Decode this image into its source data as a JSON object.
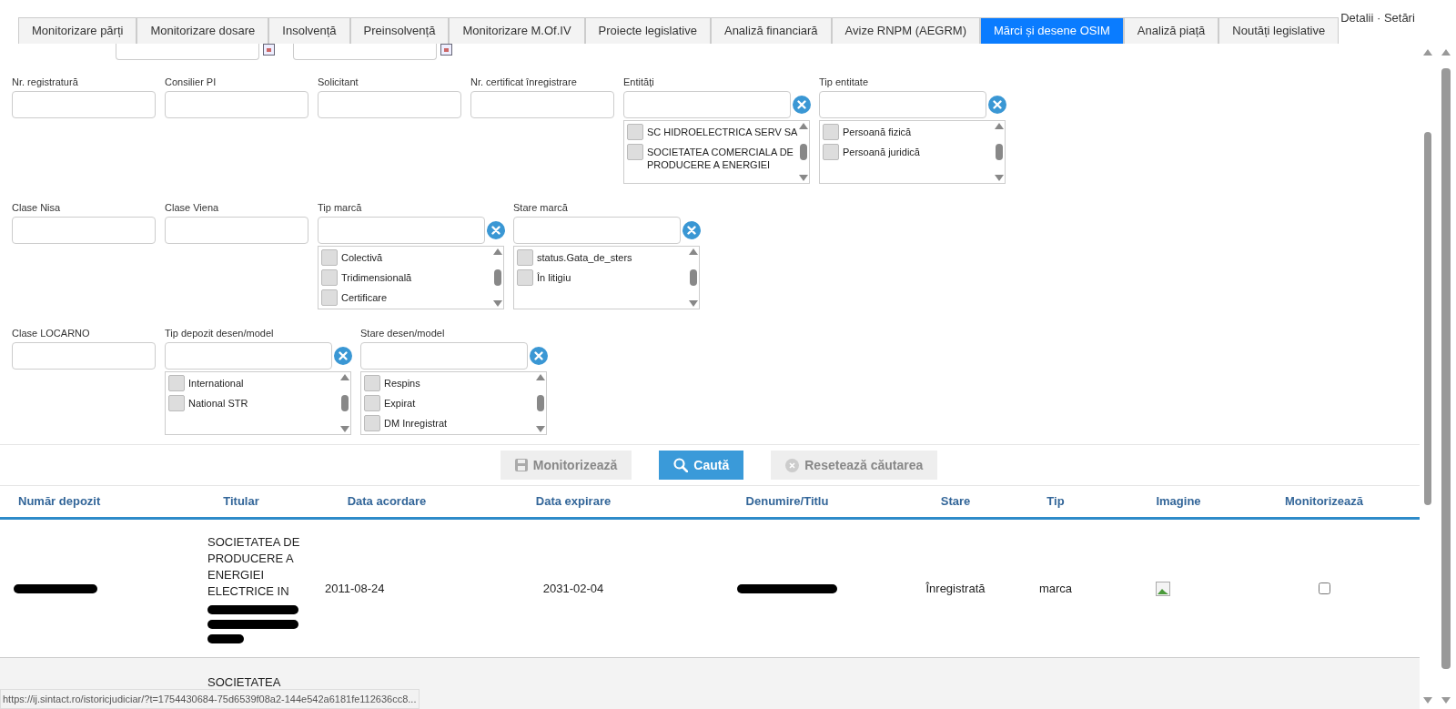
{
  "tabs": [
    {
      "label": "Monitorizare părți",
      "selected": false
    },
    {
      "label": "Monitorizare dosare",
      "selected": false
    },
    {
      "label": "Insolvență",
      "selected": false
    },
    {
      "label": "Preinsolvență",
      "selected": false
    },
    {
      "label": "Monitorizare M.Of.IV",
      "selected": false
    },
    {
      "label": "Proiecte legislative",
      "selected": false
    },
    {
      "label": "Analiză financiară",
      "selected": false
    },
    {
      "label": "Avize RNPM (AEGRM)",
      "selected": false
    },
    {
      "label": "Mărci și desene OSIM",
      "selected": true
    },
    {
      "label": "Analiză piață",
      "selected": false
    },
    {
      "label": "Noutăți legislative",
      "selected": false
    }
  ],
  "header_links": "Detalii · Setări",
  "filter_rows": [
    [
      {
        "kind": "text",
        "label": "Nr. registratură"
      },
      {
        "kind": "text",
        "label": "Consilier PI"
      },
      {
        "kind": "text",
        "label": "Solicitant"
      },
      {
        "kind": "text",
        "label": "Nr. certificat înregistrare"
      },
      {
        "kind": "list",
        "label": "Entități",
        "options": [
          {
            "label": "SC HIDROELECTRICA SERV SA",
            "checked": false
          },
          {
            "label": "SOCIETATEA COMERCIALA DE PRODUCERE A ENERGIEI",
            "checked": false
          }
        ]
      },
      {
        "kind": "list",
        "label": "Tip entitate",
        "options": [
          {
            "label": "Persoană fizică",
            "checked": false
          },
          {
            "label": "Persoană juridică",
            "checked": false
          }
        ]
      }
    ],
    [
      {
        "kind": "text",
        "label": "Clase Nisa"
      },
      {
        "kind": "text",
        "label": "Clase Viena"
      },
      {
        "kind": "list",
        "label": "Tip marcă",
        "options": [
          {
            "label": "Colectivă",
            "checked": false
          },
          {
            "label": "Tridimensională",
            "checked": false
          },
          {
            "label": "Certificare",
            "checked": false
          }
        ]
      },
      {
        "kind": "list",
        "label": "Stare marcă",
        "options": [
          {
            "label": "status.Gata_de_sters",
            "checked": false
          },
          {
            "label": "În litigiu",
            "checked": false
          }
        ]
      }
    ],
    [
      {
        "kind": "text",
        "label": "Clase LOCARNO"
      },
      {
        "kind": "list",
        "label": "Tip depozit desen/model",
        "options": [
          {
            "label": "International",
            "checked": false
          },
          {
            "label": "National STR",
            "checked": false
          }
        ]
      },
      {
        "kind": "list",
        "label": "Stare desen/model",
        "options": [
          {
            "label": "Respins",
            "checked": false
          },
          {
            "label": "Expirat",
            "checked": false
          },
          {
            "label": "DM Inregistrat",
            "checked": false
          }
        ]
      }
    ]
  ],
  "actions": [
    {
      "kind": "save",
      "label": "Monitorizează",
      "disabled": true
    },
    {
      "kind": "search",
      "label": "Caută",
      "disabled": false
    },
    {
      "kind": "reset",
      "label": "Resetează căutarea",
      "disabled": true
    }
  ],
  "table": {
    "columns": [
      "Număr depozit",
      "Titular",
      "Data acordare",
      "Data expirare",
      "Denumire/Titlu",
      "Stare",
      "Tip",
      "Imagine",
      "Monitorizează"
    ],
    "rows": [
      {
        "numar": {
          "redacted": true
        },
        "titular": {
          "text": "SOCIETATEA DE PRODUCERE A ENERGIEI ELECTRICE IN",
          "redacted": true
        },
        "data_acordare": "2011-08-24",
        "data_expirare": "2031-02-04",
        "denumire": {
          "redacted": true
        },
        "stare": "Înregistrată",
        "tip": "marca",
        "monitor": false
      },
      {
        "titular": {
          "text": "SOCIETATEA"
        }
      }
    ]
  },
  "status_bar": "https://ij.sintact.ro/istoricjudiciar/?t=1754430684-75d6539f08a2-144e542a6181fe112636cc8..."
}
